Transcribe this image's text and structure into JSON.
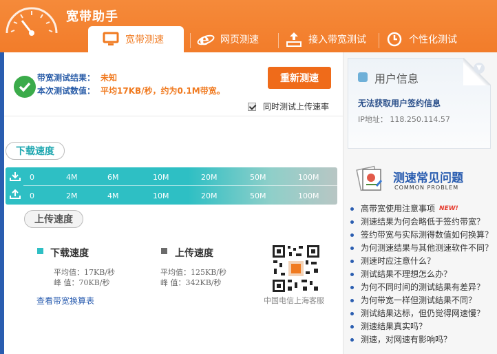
{
  "app": {
    "title": "宽带助手"
  },
  "tabs": [
    {
      "label": "宽带测速",
      "icon": "monitor-icon",
      "active": true
    },
    {
      "label": "网页测速",
      "icon": "browser-e-icon",
      "active": false
    },
    {
      "label": "接入带宽测试",
      "icon": "router-icon",
      "active": false
    },
    {
      "label": "个性化测试",
      "icon": "clock-icon",
      "active": false
    }
  ],
  "result": {
    "bandwidth_label": "带宽测试结果：",
    "bandwidth_value": "未知",
    "speed_label": "本次测试数值：",
    "speed_value": "平均17KB/秒，约为0.1M带宽。",
    "retest_button": "重新测速",
    "upload_checkbox_label": "同时测试上传速率",
    "upload_checked": true
  },
  "gauge": {
    "download_bubble": "下载速度",
    "upload_bubble": "上传速度",
    "download_ticks": [
      "0",
      "4M",
      "6M",
      "10M",
      "20M",
      "50M",
      "100M"
    ],
    "upload_ticks": [
      "0",
      "2M",
      "4M",
      "10M",
      "20M",
      "50M",
      "100M"
    ]
  },
  "stats": {
    "download_title": "下载速度",
    "download_avg": "平均值：17KB/秒",
    "download_peak": "峰  值：70KB/秒",
    "upload_title": "上传速度",
    "upload_avg": "平均值：125KB/秒",
    "upload_peak": "峰  值：342KB/秒",
    "calc_link": "查看带宽换算表",
    "qr_caption": "中国电信上海客服"
  },
  "user_info": {
    "title": "用户信息",
    "message": "无法获取用户签约信息",
    "ip": "IP地址： 118.250.114.57"
  },
  "faq": {
    "title": "测速常见问题",
    "subtitle": "COMMON PROBLEM",
    "new_badge": "NEW!",
    "items": [
      "高带宽使用注意事项",
      "测速结果为何会略低于签约带宽？",
      "签约带宽与实际测得数值如何换算？",
      "为何测速结果与其他测速软件不同？",
      "测速时应注意什么？",
      "测试结果不理想怎么办？",
      "为何不同时间的测试结果有差异？",
      "为何带宽一样但测试结果不同？",
      "测试结果达标，但仍觉得网速慢？",
      "测速结果真实吗？",
      "测速，对网速有影响吗？"
    ]
  },
  "colors": {
    "header_orange": "#f27c2a",
    "gauge_teal": "#2ebfc4",
    "link_blue": "#2a5db0",
    "ok_green": "#3bab4a"
  }
}
